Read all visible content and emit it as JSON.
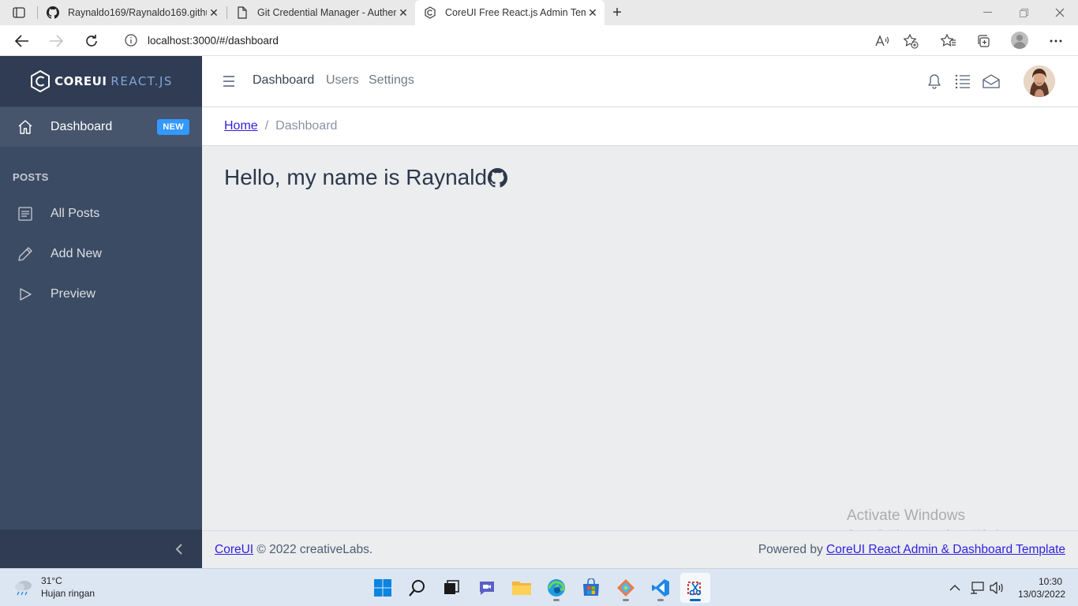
{
  "browser": {
    "tabs": [
      {
        "title": "Raynaldo169/Raynaldo169.githu",
        "icon": "github-icon"
      },
      {
        "title": "Git Credential Manager - Authen",
        "icon": "document-icon"
      },
      {
        "title": "CoreUI Free React.js Admin Temp",
        "icon": "coreui-icon",
        "active": true
      }
    ],
    "url": "localhost:3000/#/dashboard"
  },
  "sidebar": {
    "brand_core": "COREUI",
    "brand_react": "REACT.JS",
    "dashboard": {
      "label": "Dashboard",
      "badge": "NEW",
      "icon": "home-icon"
    },
    "section_title": "POSTS",
    "items": [
      {
        "label": "All Posts",
        "icon": "notes-icon"
      },
      {
        "label": "Add New",
        "icon": "pencil-icon"
      },
      {
        "label": "Preview",
        "icon": "play-icon"
      }
    ]
  },
  "header": {
    "links": [
      "Dashboard",
      "Users",
      "Settings"
    ],
    "icons": [
      "bell-icon",
      "list-icon",
      "envelope-icon"
    ]
  },
  "breadcrumb": {
    "home": "Home",
    "separator": "/",
    "current": "Dashboard"
  },
  "main": {
    "heading": "Hello, my name is Raynald"
  },
  "watermark": {
    "title": "Activate Windows",
    "subtitle": "Go to Settings to activate Windows."
  },
  "footer": {
    "brand_link": "CoreUI",
    "copyright": " © 2022 creativeLabs.",
    "powered_by": "Powered by ",
    "template_link": "CoreUI React Admin & Dashboard Template"
  },
  "taskbar": {
    "temperature": "31°C",
    "weather": "Hujan ringan",
    "time": "10:30",
    "date": "13/03/2022"
  },
  "colors": {
    "sidebar": "#3c4b64",
    "sidebar_dark": "#303c54",
    "badge": "#3399ff",
    "link": "#321fdb",
    "body_bg": "#ebedef"
  }
}
